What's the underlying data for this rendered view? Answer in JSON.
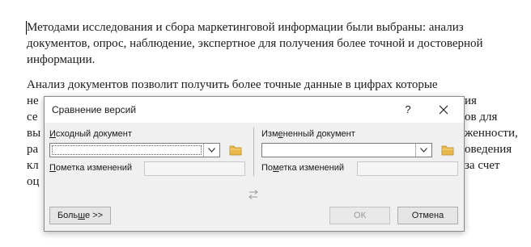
{
  "document": {
    "paragraph1": "Методами исследования и сбора маркетинговой информации были выбраны: анализ документов, опрос, наблюдение, экспертное для получения более точной и достоверной информации.",
    "paragraph2_line1": "Анализ документов позволит получить более точные данные в цифрах которые",
    "paragraph2_line2_right": "ия",
    "paragraph2_line3_right": "ов для",
    "paragraph2_line4_right": "женности,",
    "paragraph2_line5_right": "оведения",
    "paragraph2_line6_right": "за счет",
    "left_frag1": "не",
    "left_frag2": "се",
    "left_frag3": "вы",
    "left_frag4": "ра",
    "left_frag5": "кл",
    "left_frag6": "оц"
  },
  "dialog": {
    "title": "Сравнение версий",
    "help": "?",
    "original": {
      "label_prefix": "",
      "label_underlined": "И",
      "label_rest": "сходный документ",
      "value": "",
      "markup_label_underlined": "П",
      "markup_label_rest": "ометка изменений",
      "markup_value": ""
    },
    "revised": {
      "label_prefix": "Изм",
      "label_underlined": "е",
      "label_rest": "ненный документ",
      "value": "",
      "markup_label_prefix": "По",
      "markup_label_underlined": "м",
      "markup_label_rest": "етка изменений",
      "markup_value": ""
    },
    "more_button": {
      "prefix": "Боль",
      "underlined": "ш",
      "rest": "е >>"
    },
    "ok_button": "ОК",
    "cancel_button": "Отмена"
  },
  "icons": {
    "help": "question-mark-icon",
    "close": "close-icon",
    "dropdown": "chevron-down-icon",
    "folder": "folder-icon",
    "swap": "swap-arrows-icon"
  },
  "colors": {
    "folder": "#e8b84a",
    "dialog_bg": "#f0f0f0",
    "titlebar_bg": "#ffffff"
  }
}
